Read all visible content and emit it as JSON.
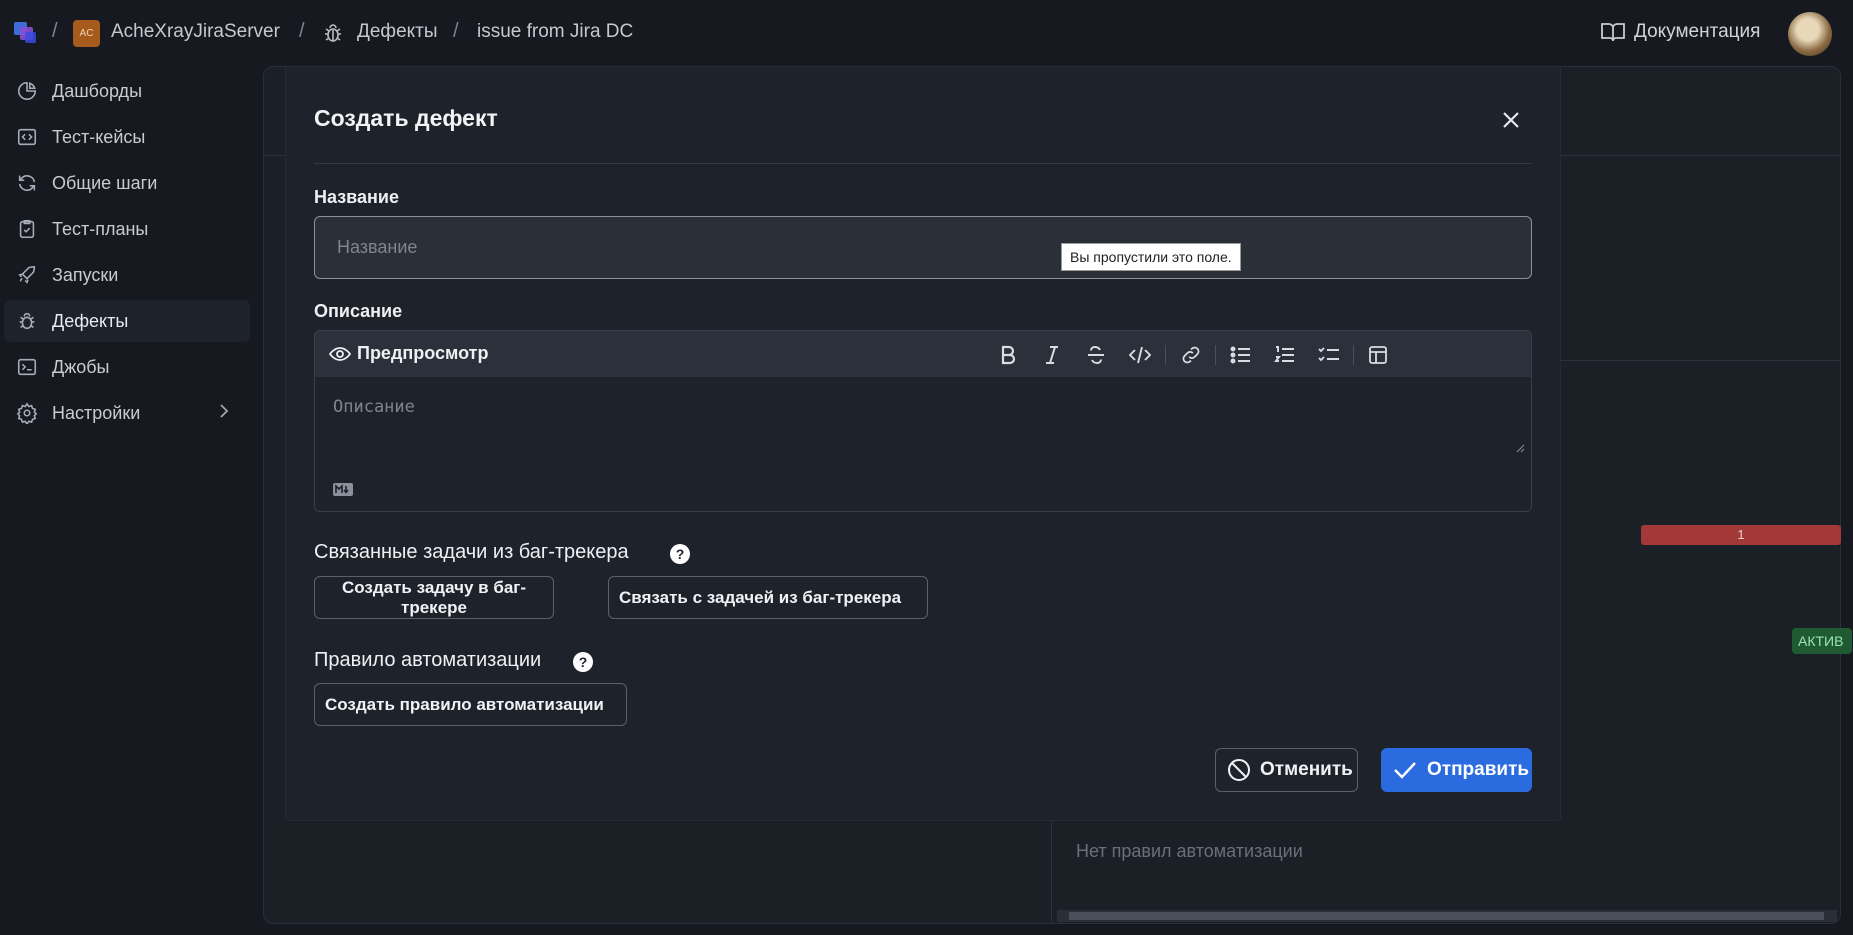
{
  "breadcrumb": {
    "project_badge": "AC",
    "project_name": "AcheXrayJiraServer",
    "section": "Дефекты",
    "issue": "issue from Jira DC",
    "separator": "/"
  },
  "header": {
    "docs_label": "Документация"
  },
  "sidebar": {
    "items": [
      {
        "label": "Дашборды",
        "icon": "pie-chart-icon"
      },
      {
        "label": "Тест-кейсы",
        "icon": "code-square-icon"
      },
      {
        "label": "Общие шаги",
        "icon": "refresh-icon"
      },
      {
        "label": "Тест-планы",
        "icon": "clipboard-check-icon"
      },
      {
        "label": "Запуски",
        "icon": "rocket-icon"
      },
      {
        "label": "Дефекты",
        "icon": "bug-icon",
        "active": true
      },
      {
        "label": "Джобы",
        "icon": "terminal-icon"
      },
      {
        "label": "Настройки",
        "icon": "gear-icon",
        "has_children": true
      }
    ]
  },
  "background": {
    "red_bar_value": "1",
    "badge_text": "АКТИВ",
    "no_rules_text": "Нет правил автоматизации"
  },
  "modal": {
    "title": "Создать дефект",
    "name_label": "Название",
    "name_placeholder": "Название",
    "name_value": "",
    "validation_tooltip": "Вы пропустили это поле.",
    "description_label": "Описание",
    "preview_label": "Предпросмотр",
    "description_placeholder": "Описание",
    "toolbar_tools": [
      "bold",
      "italic",
      "strikethrough",
      "code",
      "link",
      "bullet-list",
      "numbered-list",
      "checklist",
      "table"
    ],
    "linked_tasks_title": "Связанные задачи из баг-трекера",
    "create_issue_button": "Создать задачу в баг-трекере",
    "link_issue_button": "Связать с задачей из баг-трекера",
    "automation_title": "Правило автоматизации",
    "create_rule_button": "Создать правило автоматизации",
    "cancel_button": "Отменить",
    "submit_button": "Отправить"
  },
  "colors": {
    "background": "#16191f",
    "modal": "#1e232b",
    "accent": "#2b6be0",
    "danger": "#a33838",
    "success": "#1f5a32"
  }
}
